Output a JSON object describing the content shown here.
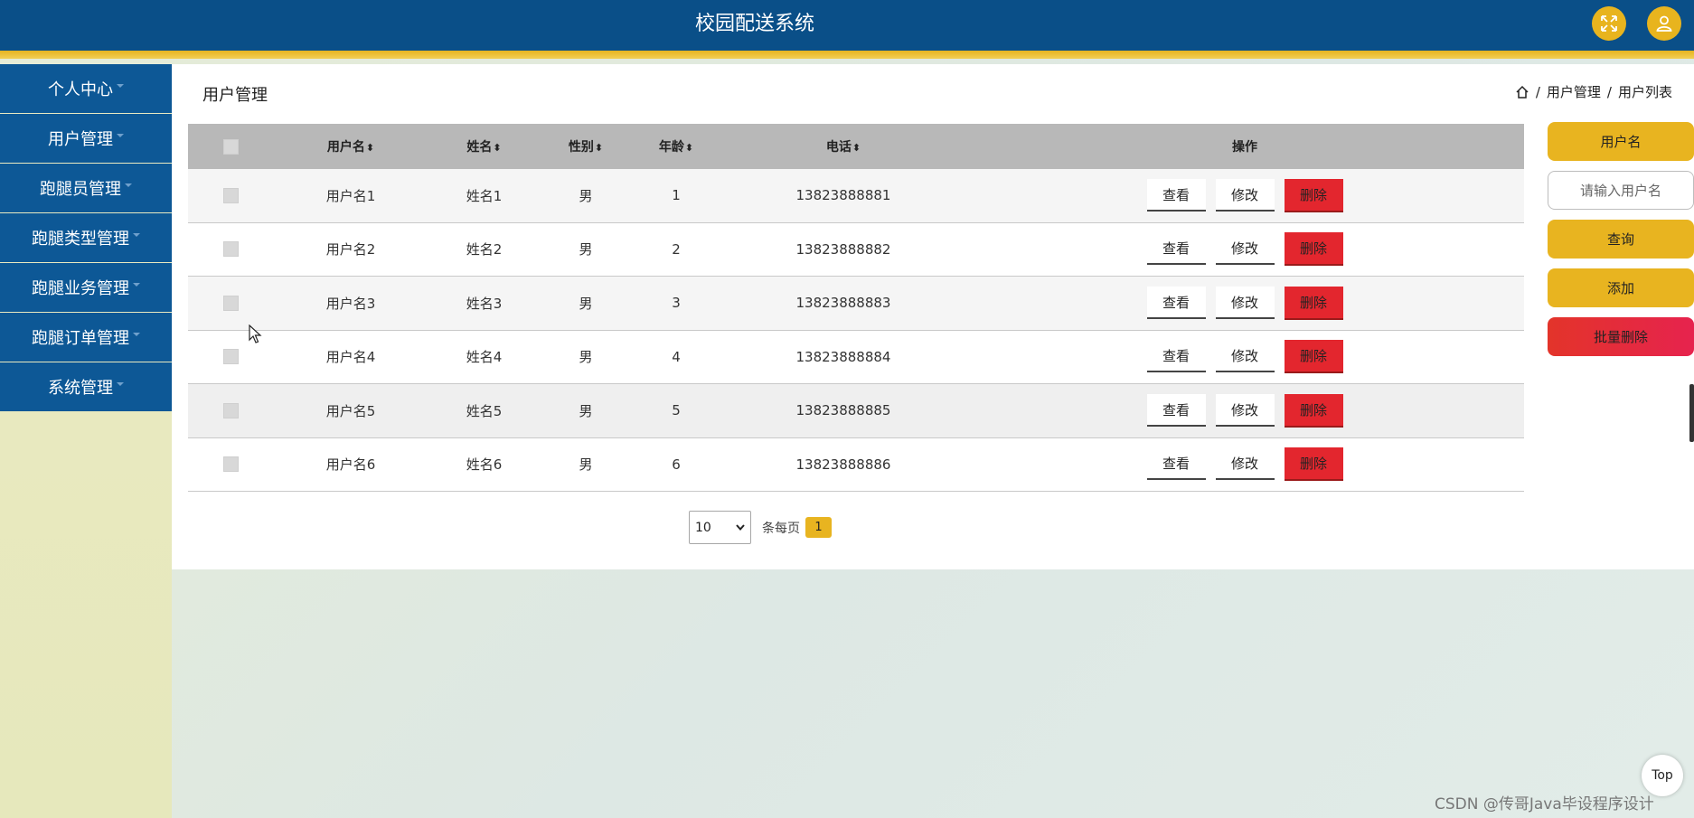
{
  "header": {
    "title": "校园配送系统"
  },
  "sidebar": {
    "items": [
      {
        "label": "个人中心"
      },
      {
        "label": "用户管理"
      },
      {
        "label": "跑腿员管理"
      },
      {
        "label": "跑腿类型管理"
      },
      {
        "label": "跑腿业务管理"
      },
      {
        "label": "跑腿订单管理"
      },
      {
        "label": "系统管理"
      }
    ]
  },
  "main": {
    "title": "用户管理",
    "breadcrumb": [
      "用户管理",
      "用户列表"
    ],
    "breadcrumb_sep": "/",
    "table": {
      "columns": [
        "用户名",
        "姓名",
        "性别",
        "年龄",
        "电话",
        "操作"
      ],
      "sort_glyph": "⬍",
      "rows": [
        {
          "username": "用户名1",
          "name": "姓名1",
          "gender": "男",
          "age": "1",
          "phone": "13823888881"
        },
        {
          "username": "用户名2",
          "name": "姓名2",
          "gender": "男",
          "age": "2",
          "phone": "13823888882"
        },
        {
          "username": "用户名3",
          "name": "姓名3",
          "gender": "男",
          "age": "3",
          "phone": "13823888883"
        },
        {
          "username": "用户名4",
          "name": "姓名4",
          "gender": "男",
          "age": "4",
          "phone": "13823888884"
        },
        {
          "username": "用户名5",
          "name": "姓名5",
          "gender": "男",
          "age": "5",
          "phone": "13823888885"
        },
        {
          "username": "用户名6",
          "name": "姓名6",
          "gender": "男",
          "age": "6",
          "phone": "13823888886"
        }
      ],
      "actions": {
        "view": "查看",
        "edit": "修改",
        "delete": "删除"
      }
    },
    "pagination": {
      "page_size": "10",
      "per_page_label": "条每页",
      "current_page": "1"
    }
  },
  "search_panel": {
    "label": "用户名",
    "placeholder": "请输入用户名",
    "query_label": "查询",
    "add_label": "添加",
    "bulk_delete_label": "批量删除"
  },
  "top_button": "Top",
  "watermark": "CSDN @传哥Java毕设程序设计",
  "colors": {
    "header": "#0a4f88",
    "accent": "#e8b420",
    "danger": "#e3262e",
    "sidebar_item": "#0d5896"
  }
}
